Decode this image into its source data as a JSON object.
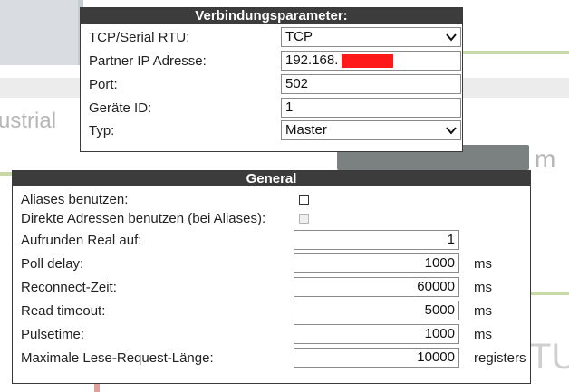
{
  "connection": {
    "title": "Verbindungsparameter:",
    "protocol": {
      "label": "TCP/Serial RTU:",
      "value": "TCP"
    },
    "partner_ip": {
      "label": "Partner IP Adresse:",
      "value": "192.168."
    },
    "port": {
      "label": "Port:",
      "value": "502"
    },
    "device_id": {
      "label": "Geräte ID:",
      "value": "1"
    },
    "type": {
      "label": "Typ:",
      "value": "Master"
    }
  },
  "general": {
    "title": "General",
    "use_aliases": {
      "label": "Aliases benutzen:",
      "checked": false
    },
    "direct_addresses": {
      "label": "Direkte Adressen benutzen (bei Aliases):",
      "checked": false,
      "disabled": true
    },
    "round_real": {
      "label": "Aufrunden Real auf:",
      "value": "1"
    },
    "poll_delay": {
      "label": "Poll delay:",
      "value": "1000",
      "unit": "ms"
    },
    "reconnect": {
      "label": "Reconnect-Zeit:",
      "value": "60000",
      "unit": "ms"
    },
    "read_timeout": {
      "label": "Read timeout:",
      "value": "5000",
      "unit": "ms"
    },
    "pulsetime": {
      "label": "Pulsetime:",
      "value": "1000",
      "unit": "ms"
    },
    "max_read_length": {
      "label": "Maximale Lese-Request-Länge:",
      "value": "10000",
      "unit": "registers"
    }
  },
  "background": {
    "word_left": "ustrial",
    "word_right": "m",
    "word_bottom": "TU"
  },
  "colors": {
    "header_bg": "#3c3c3c",
    "redaction": "#ff1a1a"
  }
}
